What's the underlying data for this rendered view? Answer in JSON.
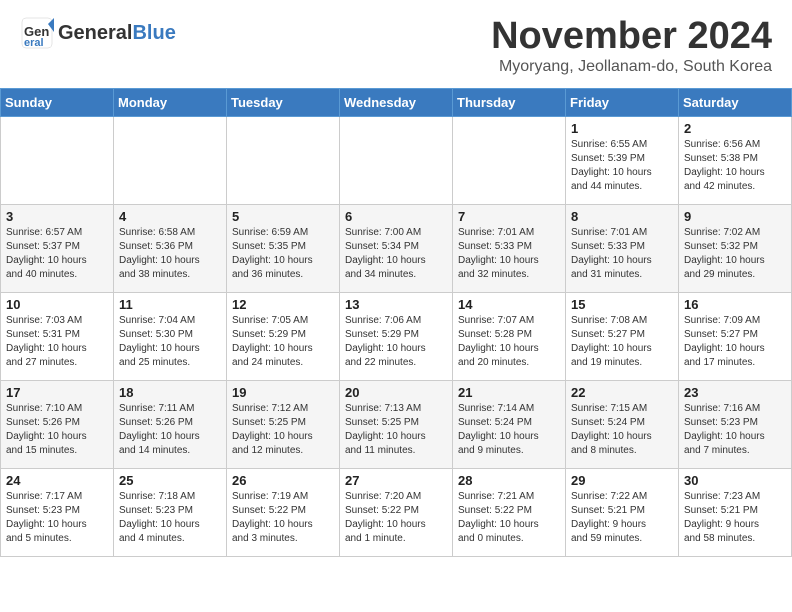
{
  "header": {
    "logo_line1": "General",
    "logo_line2": "Blue",
    "month": "November 2024",
    "location": "Myoryang, Jeollanam-do, South Korea"
  },
  "days_of_week": [
    "Sunday",
    "Monday",
    "Tuesday",
    "Wednesday",
    "Thursday",
    "Friday",
    "Saturday"
  ],
  "weeks": [
    [
      {
        "day": "",
        "info": ""
      },
      {
        "day": "",
        "info": ""
      },
      {
        "day": "",
        "info": ""
      },
      {
        "day": "",
        "info": ""
      },
      {
        "day": "",
        "info": ""
      },
      {
        "day": "1",
        "info": "Sunrise: 6:55 AM\nSunset: 5:39 PM\nDaylight: 10 hours\nand 44 minutes."
      },
      {
        "day": "2",
        "info": "Sunrise: 6:56 AM\nSunset: 5:38 PM\nDaylight: 10 hours\nand 42 minutes."
      }
    ],
    [
      {
        "day": "3",
        "info": "Sunrise: 6:57 AM\nSunset: 5:37 PM\nDaylight: 10 hours\nand 40 minutes."
      },
      {
        "day": "4",
        "info": "Sunrise: 6:58 AM\nSunset: 5:36 PM\nDaylight: 10 hours\nand 38 minutes."
      },
      {
        "day": "5",
        "info": "Sunrise: 6:59 AM\nSunset: 5:35 PM\nDaylight: 10 hours\nand 36 minutes."
      },
      {
        "day": "6",
        "info": "Sunrise: 7:00 AM\nSunset: 5:34 PM\nDaylight: 10 hours\nand 34 minutes."
      },
      {
        "day": "7",
        "info": "Sunrise: 7:01 AM\nSunset: 5:33 PM\nDaylight: 10 hours\nand 32 minutes."
      },
      {
        "day": "8",
        "info": "Sunrise: 7:01 AM\nSunset: 5:33 PM\nDaylight: 10 hours\nand 31 minutes."
      },
      {
        "day": "9",
        "info": "Sunrise: 7:02 AM\nSunset: 5:32 PM\nDaylight: 10 hours\nand 29 minutes."
      }
    ],
    [
      {
        "day": "10",
        "info": "Sunrise: 7:03 AM\nSunset: 5:31 PM\nDaylight: 10 hours\nand 27 minutes."
      },
      {
        "day": "11",
        "info": "Sunrise: 7:04 AM\nSunset: 5:30 PM\nDaylight: 10 hours\nand 25 minutes."
      },
      {
        "day": "12",
        "info": "Sunrise: 7:05 AM\nSunset: 5:29 PM\nDaylight: 10 hours\nand 24 minutes."
      },
      {
        "day": "13",
        "info": "Sunrise: 7:06 AM\nSunset: 5:29 PM\nDaylight: 10 hours\nand 22 minutes."
      },
      {
        "day": "14",
        "info": "Sunrise: 7:07 AM\nSunset: 5:28 PM\nDaylight: 10 hours\nand 20 minutes."
      },
      {
        "day": "15",
        "info": "Sunrise: 7:08 AM\nSunset: 5:27 PM\nDaylight: 10 hours\nand 19 minutes."
      },
      {
        "day": "16",
        "info": "Sunrise: 7:09 AM\nSunset: 5:27 PM\nDaylight: 10 hours\nand 17 minutes."
      }
    ],
    [
      {
        "day": "17",
        "info": "Sunrise: 7:10 AM\nSunset: 5:26 PM\nDaylight: 10 hours\nand 15 minutes."
      },
      {
        "day": "18",
        "info": "Sunrise: 7:11 AM\nSunset: 5:26 PM\nDaylight: 10 hours\nand 14 minutes."
      },
      {
        "day": "19",
        "info": "Sunrise: 7:12 AM\nSunset: 5:25 PM\nDaylight: 10 hours\nand 12 minutes."
      },
      {
        "day": "20",
        "info": "Sunrise: 7:13 AM\nSunset: 5:25 PM\nDaylight: 10 hours\nand 11 minutes."
      },
      {
        "day": "21",
        "info": "Sunrise: 7:14 AM\nSunset: 5:24 PM\nDaylight: 10 hours\nand 9 minutes."
      },
      {
        "day": "22",
        "info": "Sunrise: 7:15 AM\nSunset: 5:24 PM\nDaylight: 10 hours\nand 8 minutes."
      },
      {
        "day": "23",
        "info": "Sunrise: 7:16 AM\nSunset: 5:23 PM\nDaylight: 10 hours\nand 7 minutes."
      }
    ],
    [
      {
        "day": "24",
        "info": "Sunrise: 7:17 AM\nSunset: 5:23 PM\nDaylight: 10 hours\nand 5 minutes."
      },
      {
        "day": "25",
        "info": "Sunrise: 7:18 AM\nSunset: 5:23 PM\nDaylight: 10 hours\nand 4 minutes."
      },
      {
        "day": "26",
        "info": "Sunrise: 7:19 AM\nSunset: 5:22 PM\nDaylight: 10 hours\nand 3 minutes."
      },
      {
        "day": "27",
        "info": "Sunrise: 7:20 AM\nSunset: 5:22 PM\nDaylight: 10 hours\nand 1 minute."
      },
      {
        "day": "28",
        "info": "Sunrise: 7:21 AM\nSunset: 5:22 PM\nDaylight: 10 hours\nand 0 minutes."
      },
      {
        "day": "29",
        "info": "Sunrise: 7:22 AM\nSunset: 5:21 PM\nDaylight: 9 hours\nand 59 minutes."
      },
      {
        "day": "30",
        "info": "Sunrise: 7:23 AM\nSunset: 5:21 PM\nDaylight: 9 hours\nand 58 minutes."
      }
    ]
  ]
}
